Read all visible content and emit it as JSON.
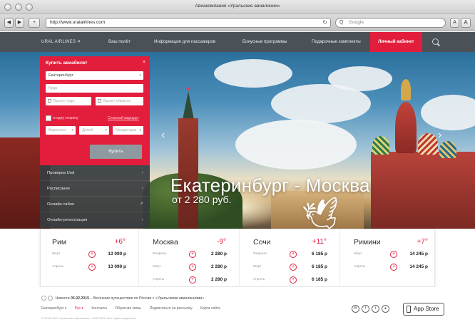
{
  "window": {
    "title": "Авиакомпания «Уральские авиалинии»"
  },
  "browser": {
    "back": "◀",
    "forward": "▶",
    "add": "+",
    "url": "http://www.uralairlines.com",
    "search_placeholder": "Google",
    "font_small": "A",
    "font_large": "A"
  },
  "nav": {
    "logo": "URAL AIRLINES",
    "items": [
      "Ваш полёт",
      "Информация для пассажиров",
      "Бонусные программы",
      "Подарочные комплекты"
    ],
    "cabinet": "Личный кабинет"
  },
  "hero": {
    "title": "Екатеринбург - Москва",
    "price": "от 2 280 руб."
  },
  "booking": {
    "title": "Купить авиабилет",
    "from": "Екатеринбург",
    "to_placeholder": "Куда",
    "date_there": "Вылет туда",
    "date_back": "Вылет обратно",
    "one_way": "в одну сторону",
    "complex_route": "Сложный маршрут",
    "adults": "Взрослых",
    "children": "Детей",
    "infants": "Младенцев",
    "buy": "Купить"
  },
  "menu": [
    "Проверка Ural",
    "Расписание",
    "Онлайн-табло",
    "Онлайн-регистрация"
  ],
  "cities": [
    {
      "name": "Рим",
      "temp": "+6°",
      "fares": [
        {
          "date": "Март",
          "price": "13 090 р"
        },
        {
          "date": "Апрель",
          "price": "13 090 р"
        }
      ]
    },
    {
      "name": "Москва",
      "temp": "-9°",
      "fares": [
        {
          "date": "Февраль",
          "price": "2 280 р"
        },
        {
          "date": "Март",
          "price": "2 280 р"
        },
        {
          "date": "Апрель",
          "price": "2 280 р"
        }
      ]
    },
    {
      "name": "Сочи",
      "temp": "+11°",
      "fares": [
        {
          "date": "Февраль",
          "price": "6 185 р"
        },
        {
          "date": "Март",
          "price": "6 185 р"
        },
        {
          "date": "Апрель",
          "price": "6 185 р"
        }
      ]
    },
    {
      "name": "Римини",
      "temp": "+7°",
      "fares": [
        {
          "date": "Март",
          "price": "14 245 р"
        },
        {
          "date": "Апрель",
          "price": "14 245 р"
        }
      ]
    }
  ],
  "footer": {
    "news_prefix": "Новости",
    "news_date": "05.02.2015",
    "news_text": "– Весенние путешествия по России с «Уральскими авиалиниями»",
    "links": [
      "Екатеринбург ▾",
      "Рус ▾",
      "Контакты",
      "Обратная связь",
      "Подписаться на рассылку",
      "Карта сайта"
    ],
    "social": [
      "В",
      "f",
      "t",
      "●"
    ],
    "appstore": "App Store",
    "copyright": "© 2015 ОАО «Уральские авиалинии». 1993-2015. Все права защищены."
  },
  "colors": {
    "brand_red": "#e31e3c",
    "nav_bg": "#4a5257"
  }
}
